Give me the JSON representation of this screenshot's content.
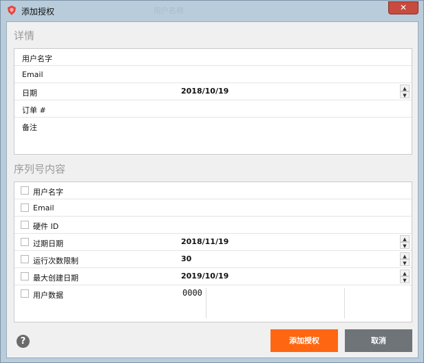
{
  "window": {
    "title": "添加授权",
    "close_label": "✕",
    "background_ghost_text": "用户名称"
  },
  "details": {
    "title": "详情",
    "fields": [
      {
        "label": "用户名字",
        "value": ""
      },
      {
        "label": "Email",
        "value": ""
      },
      {
        "label": "日期",
        "value": "2018/10/19"
      },
      {
        "label": "订单 #",
        "value": ""
      },
      {
        "label": "备注",
        "value": ""
      }
    ]
  },
  "serial": {
    "title": "序列号内容",
    "fields": [
      {
        "label": "用户名字",
        "checked": false,
        "value": ""
      },
      {
        "label": "Email",
        "checked": false,
        "value": ""
      },
      {
        "label": "硬件 ID",
        "checked": false,
        "value": ""
      },
      {
        "label": "过期日期",
        "checked": false,
        "value": "2018/11/19"
      },
      {
        "label": "运行次数限制",
        "checked": false,
        "value": "30"
      },
      {
        "label": "最大创建日期",
        "checked": false,
        "value": "2019/10/19"
      },
      {
        "label": "用户数据",
        "checked": false,
        "value": "0000"
      }
    ]
  },
  "footer": {
    "help_label": "?",
    "add_button": "添加授权",
    "cancel_button": "取消"
  },
  "colors": {
    "accent": "#ff6611",
    "cancel": "#6f7479",
    "titlebar": "#b9ccdb",
    "close": "#c74b3f"
  },
  "icons": {
    "app": "app-logo-icon",
    "close": "close-icon",
    "help": "help-icon",
    "spin_up": "spin-up-icon",
    "spin_down": "spin-down-icon"
  }
}
